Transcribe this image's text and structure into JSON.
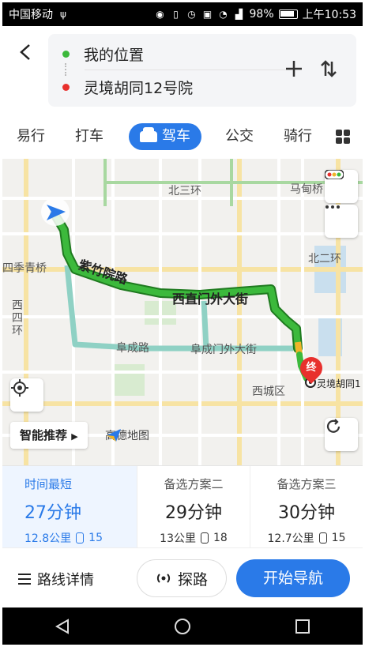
{
  "status_bar": {
    "carrier": "中国移动",
    "battery_percent": "98%",
    "time": "上午10:53"
  },
  "header": {
    "origin": "我的位置",
    "destination": "灵境胡同12号院"
  },
  "tabs": [
    {
      "label": "易行"
    },
    {
      "label": "打车"
    },
    {
      "label": "驾车",
      "active": true
    },
    {
      "label": "公交"
    },
    {
      "label": "骑行"
    }
  ],
  "map": {
    "labels": {
      "beisanhuan": "北三环",
      "madianqiao": "马甸桥",
      "beierhuan": "北二环",
      "siji_qingqiao": "四季青桥",
      "xisihuan": "西四环",
      "fuchenglu": "阜成路",
      "fuchengmenwai": "阜成门外大街",
      "xicheng": "西城区",
      "dest_short": "灵境胡同1",
      "amap_logo": "高德地图"
    },
    "route_labels": {
      "zizhuyuan": "紫竹院路",
      "xizhimenwai": "西直门外大街"
    },
    "end_marker": "终",
    "smart_recommend": "智能推荐"
  },
  "routes": [
    {
      "title": "时间最短",
      "time": "27分钟",
      "distance": "12.8公里",
      "lights": "15",
      "selected": true
    },
    {
      "title": "备选方案二",
      "time": "29分钟",
      "distance": "13公里",
      "lights": "18"
    },
    {
      "title": "备选方案三",
      "time": "30分钟",
      "distance": "12.7公里",
      "lights": "15"
    }
  ],
  "actions": {
    "detail": "路线详情",
    "explore": "探路",
    "navigate": "开始导航"
  },
  "colors": {
    "accent": "#2a7ae8",
    "route_green": "#3cb93c",
    "route_yellow": "#f0b429",
    "route_red": "#e8302d",
    "alt_route": "#8fd1c4"
  }
}
